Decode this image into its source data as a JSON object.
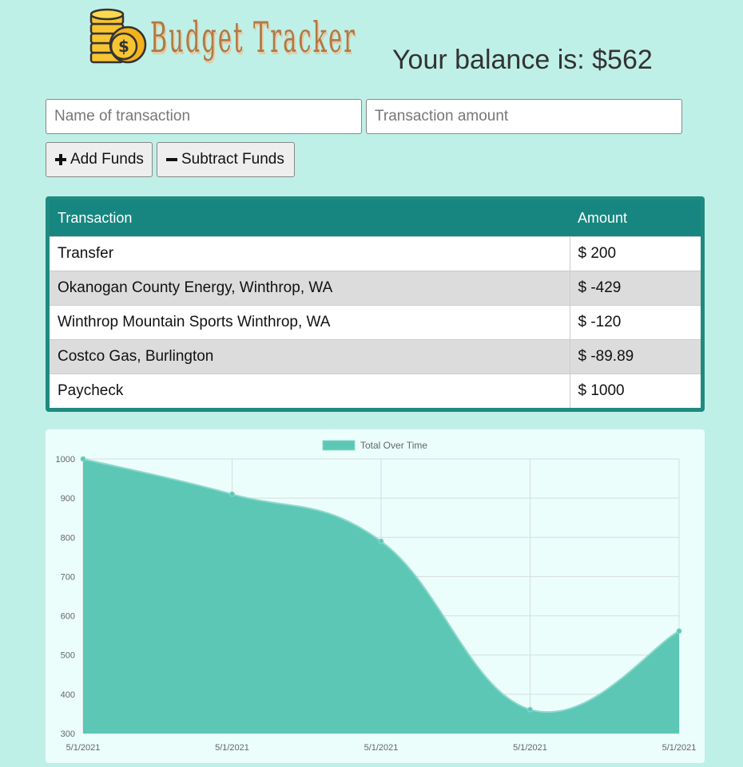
{
  "header": {
    "logo_text": "Budget Tracker",
    "balance_label": "Your balance is: $562"
  },
  "form": {
    "name_placeholder": "Name of transaction",
    "amount_placeholder": "Transaction amount",
    "add_label": "Add Funds",
    "subtract_label": "Subtract Funds"
  },
  "table": {
    "headers": [
      "Transaction",
      "Amount"
    ],
    "rows": [
      {
        "name": "Transfer",
        "amount": "$ 200"
      },
      {
        "name": "Okanogan County Energy, Winthrop, WA",
        "amount": "$ -429"
      },
      {
        "name": "Winthrop Mountain Sports Winthrop, WA",
        "amount": "$ -120"
      },
      {
        "name": "Costco Gas, Burlington",
        "amount": "$ -89.89"
      },
      {
        "name": "Paycheck",
        "amount": "$ 1000"
      }
    ]
  },
  "colors": {
    "background": "#bff0e7",
    "table_header": "#178680",
    "area_fill": "#5cc7b5",
    "area_stroke": "#8fd9cd"
  },
  "chart_data": {
    "type": "area",
    "legend": "Total Over Time",
    "legend_position": "top",
    "grid": true,
    "x": [
      "5/1/2021",
      "5/1/2021",
      "5/1/2021",
      "5/1/2021",
      "5/1/2021"
    ],
    "series": [
      {
        "name": "Total Over Time",
        "values": [
          1000,
          910.11,
          790.11,
          361.11,
          561.11
        ]
      }
    ],
    "ylim": [
      300,
      1000
    ],
    "yticks": [
      300,
      400,
      500,
      600,
      700,
      800,
      900,
      1000
    ]
  }
}
